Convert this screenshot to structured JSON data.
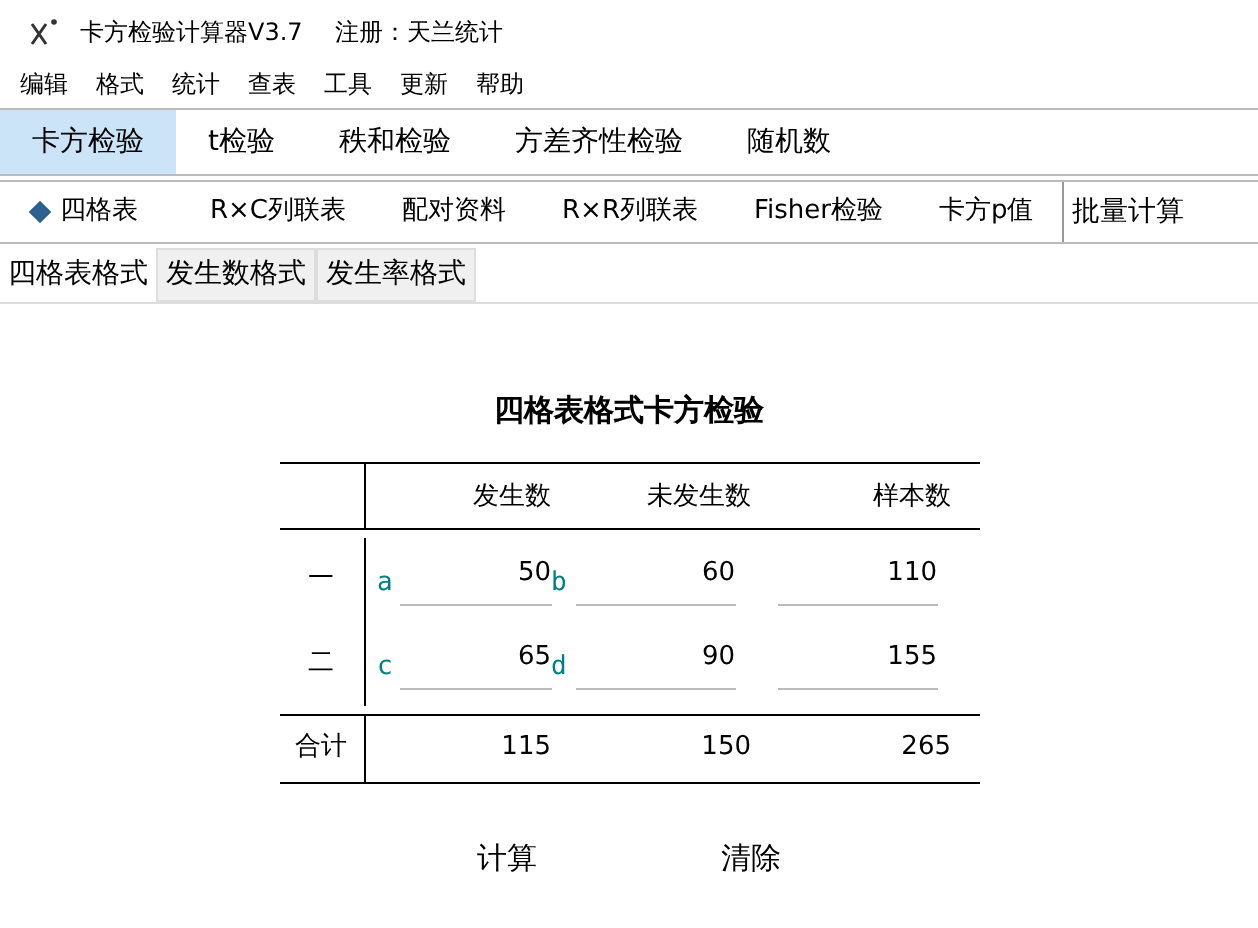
{
  "window": {
    "title": "卡方检验计算器V3.7",
    "registration": "注册：天兰统计"
  },
  "menu": [
    "编辑",
    "格式",
    "统计",
    "查表",
    "工具",
    "更新",
    "帮助"
  ],
  "main_tabs": [
    {
      "label": "卡方检验",
      "selected": true
    },
    {
      "label": "t检验",
      "selected": false
    },
    {
      "label": "秩和检验",
      "selected": false
    },
    {
      "label": "方差齐性检验",
      "selected": false
    },
    {
      "label": "随机数",
      "selected": false
    }
  ],
  "sub_tabs": [
    {
      "label": "四格表",
      "selected": true
    },
    {
      "label": "R×C列联表",
      "selected": false
    },
    {
      "label": "配对资料",
      "selected": false
    },
    {
      "label": "R×R列联表",
      "selected": false
    },
    {
      "label": "Fisher检验",
      "selected": false
    },
    {
      "label": "卡方p值",
      "selected": false
    }
  ],
  "batch_button": "批量计算",
  "format_tabs": [
    {
      "label": "四格表格式",
      "selected": true
    },
    {
      "label": "发生数格式",
      "selected": false
    },
    {
      "label": "发生率格式",
      "selected": false
    }
  ],
  "panel": {
    "title": "四格表格式卡方检验",
    "columns": [
      "发生数",
      "未发生数",
      "样本数"
    ],
    "rows": [
      {
        "label": "一",
        "cells": [
          {
            "kind": "input",
            "prefix": "a",
            "value": "50"
          },
          {
            "kind": "input",
            "prefix": "b",
            "value": "60"
          },
          {
            "kind": "output",
            "value": "110"
          }
        ]
      },
      {
        "label": "二",
        "cells": [
          {
            "kind": "input",
            "prefix": "c",
            "value": "65"
          },
          {
            "kind": "input",
            "prefix": "d",
            "value": "90"
          },
          {
            "kind": "output",
            "value": "155"
          }
        ]
      }
    ],
    "total": {
      "label": "合计",
      "values": [
        "115",
        "150",
        "265"
      ]
    },
    "buttons": [
      "计算",
      "清除"
    ]
  }
}
